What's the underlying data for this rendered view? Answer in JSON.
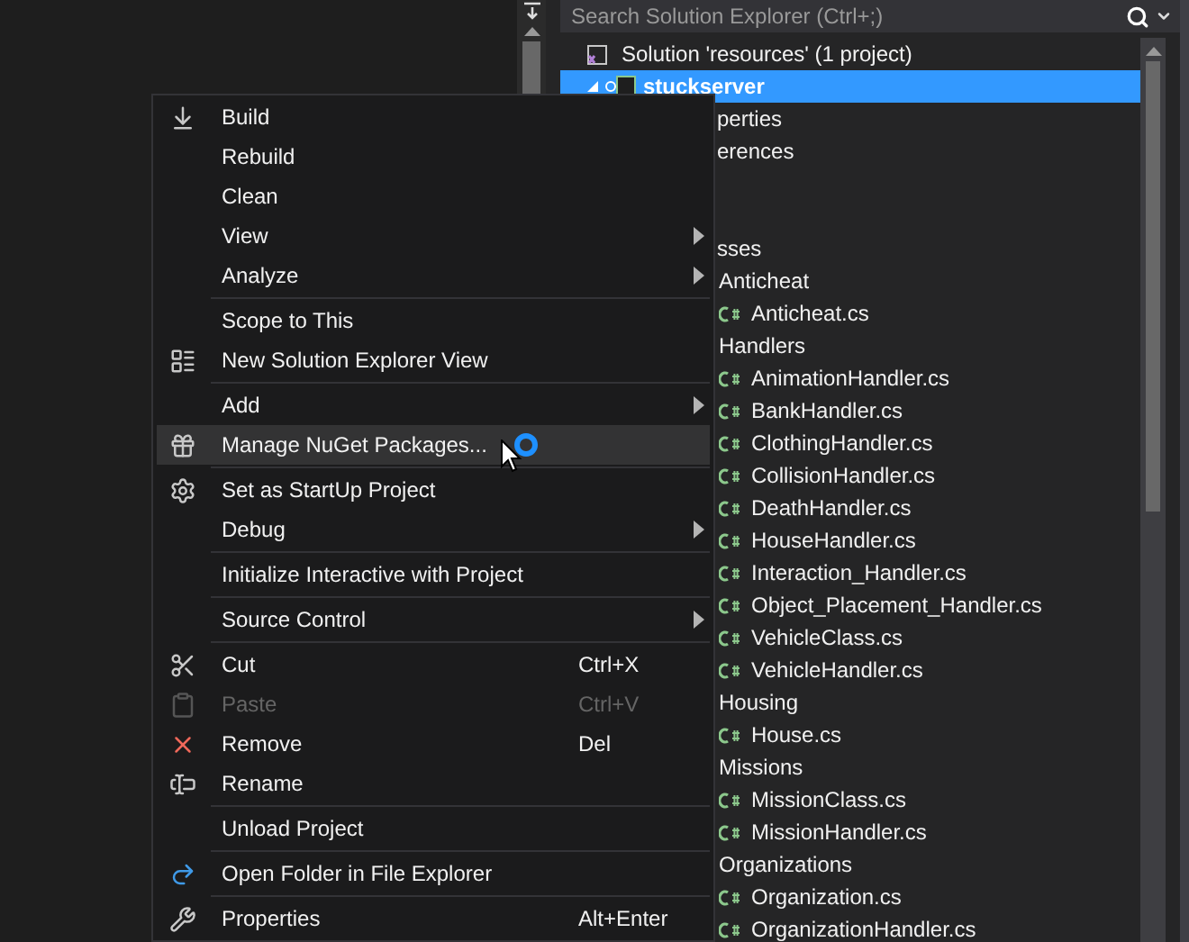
{
  "solution_explorer": {
    "search": {
      "placeholder": "Search Solution Explorer (Ctrl+;)"
    },
    "top_rows": [
      {
        "kind": "solution",
        "text": "Solution 'resources' (1 project)",
        "selected": false
      },
      {
        "kind": "project",
        "text": "stuckserver",
        "selected": true
      },
      {
        "kind": "partial",
        "text": "perties",
        "selected": false
      },
      {
        "kind": "partial",
        "text": "erences",
        "selected": false
      }
    ],
    "rows": [
      {
        "kind": "partial",
        "text": "sses",
        "selected": false
      },
      {
        "kind": "folder",
        "text": "Anticheat",
        "selected": false
      },
      {
        "kind": "file",
        "text": "Anticheat.cs",
        "selected": false
      },
      {
        "kind": "folder",
        "text": "Handlers",
        "selected": false
      },
      {
        "kind": "file",
        "text": "AnimationHandler.cs",
        "selected": false
      },
      {
        "kind": "file",
        "text": "BankHandler.cs",
        "selected": false
      },
      {
        "kind": "file",
        "text": "ClothingHandler.cs",
        "selected": false
      },
      {
        "kind": "file",
        "text": "CollisionHandler.cs",
        "selected": false
      },
      {
        "kind": "file",
        "text": "DeathHandler.cs",
        "selected": false
      },
      {
        "kind": "file",
        "text": "HouseHandler.cs",
        "selected": false
      },
      {
        "kind": "file",
        "text": "Interaction_Handler.cs",
        "selected": false
      },
      {
        "kind": "file",
        "text": "Object_Placement_Handler.cs",
        "selected": false
      },
      {
        "kind": "file",
        "text": "VehicleClass.cs",
        "selected": false
      },
      {
        "kind": "file",
        "text": "VehicleHandler.cs",
        "selected": false
      },
      {
        "kind": "folder",
        "text": "Housing",
        "selected": false
      },
      {
        "kind": "file",
        "text": "House.cs",
        "selected": false
      },
      {
        "kind": "folder",
        "text": "Missions",
        "selected": false
      },
      {
        "kind": "file",
        "text": "MissionClass.cs",
        "selected": false
      },
      {
        "kind": "file",
        "text": "MissionHandler.cs",
        "selected": false
      },
      {
        "kind": "folder",
        "text": "Organizations",
        "selected": false
      },
      {
        "kind": "file",
        "text": "Organization.cs",
        "selected": false
      },
      {
        "kind": "file",
        "text": "OrganizationHandler.cs",
        "selected": false
      }
    ]
  },
  "context_menu": [
    {
      "kind": "build",
      "label": "Build",
      "submenu": false,
      "disabled": false,
      "selected": false
    },
    {
      "kind": "item",
      "label": "Rebuild",
      "submenu": false,
      "disabled": false,
      "selected": false
    },
    {
      "kind": "item",
      "label": "Clean",
      "submenu": false,
      "disabled": false,
      "selected": false
    },
    {
      "kind": "item",
      "label": "View",
      "submenu": true,
      "disabled": false,
      "selected": false
    },
    {
      "kind": "item",
      "label": "Analyze",
      "submenu": true,
      "disabled": false,
      "selected": false
    },
    {
      "kind": "separator"
    },
    {
      "kind": "item",
      "label": "Scope to This",
      "submenu": false,
      "disabled": false,
      "selected": false
    },
    {
      "kind": "view",
      "label": "New Solution Explorer View",
      "submenu": false,
      "disabled": false,
      "selected": false
    },
    {
      "kind": "separator"
    },
    {
      "kind": "item",
      "label": "Add",
      "submenu": true,
      "disabled": false,
      "selected": false
    },
    {
      "kind": "package",
      "label": "Manage NuGet Packages...",
      "submenu": false,
      "disabled": false,
      "selected": true
    },
    {
      "kind": "separator"
    },
    {
      "kind": "gear",
      "label": "Set as StartUp Project",
      "submenu": false,
      "disabled": false,
      "selected": false
    },
    {
      "kind": "item",
      "label": "Debug",
      "submenu": true,
      "disabled": false,
      "selected": false
    },
    {
      "kind": "separator"
    },
    {
      "kind": "item",
      "label": "Initialize Interactive with Project",
      "submenu": false,
      "disabled": false,
      "selected": false
    },
    {
      "kind": "separator"
    },
    {
      "kind": "item",
      "label": "Source Control",
      "submenu": true,
      "disabled": false,
      "selected": false
    },
    {
      "kind": "separator"
    },
    {
      "kind": "cut",
      "label": "Cut",
      "shortcut": "Ctrl+X",
      "submenu": false,
      "disabled": false,
      "selected": false
    },
    {
      "kind": "paste",
      "label": "Paste",
      "shortcut": "Ctrl+V",
      "submenu": false,
      "disabled": true,
      "selected": false
    },
    {
      "kind": "remove",
      "label": "Remove",
      "shortcut": "Del",
      "submenu": false,
      "disabled": false,
      "selected": false
    },
    {
      "kind": "rename",
      "label": "Rename",
      "submenu": false,
      "disabled": false,
      "selected": false
    },
    {
      "kind": "separator"
    },
    {
      "kind": "item",
      "label": "Unload Project",
      "submenu": false,
      "disabled": false,
      "selected": false
    },
    {
      "kind": "separator"
    },
    {
      "kind": "open",
      "label": "Open Folder in File Explorer",
      "submenu": false,
      "disabled": false,
      "selected": false
    },
    {
      "kind": "separator"
    },
    {
      "kind": "wrench",
      "label": "Properties",
      "shortcut": "Alt+Enter",
      "submenu": false,
      "disabled": false,
      "selected": false
    }
  ]
}
